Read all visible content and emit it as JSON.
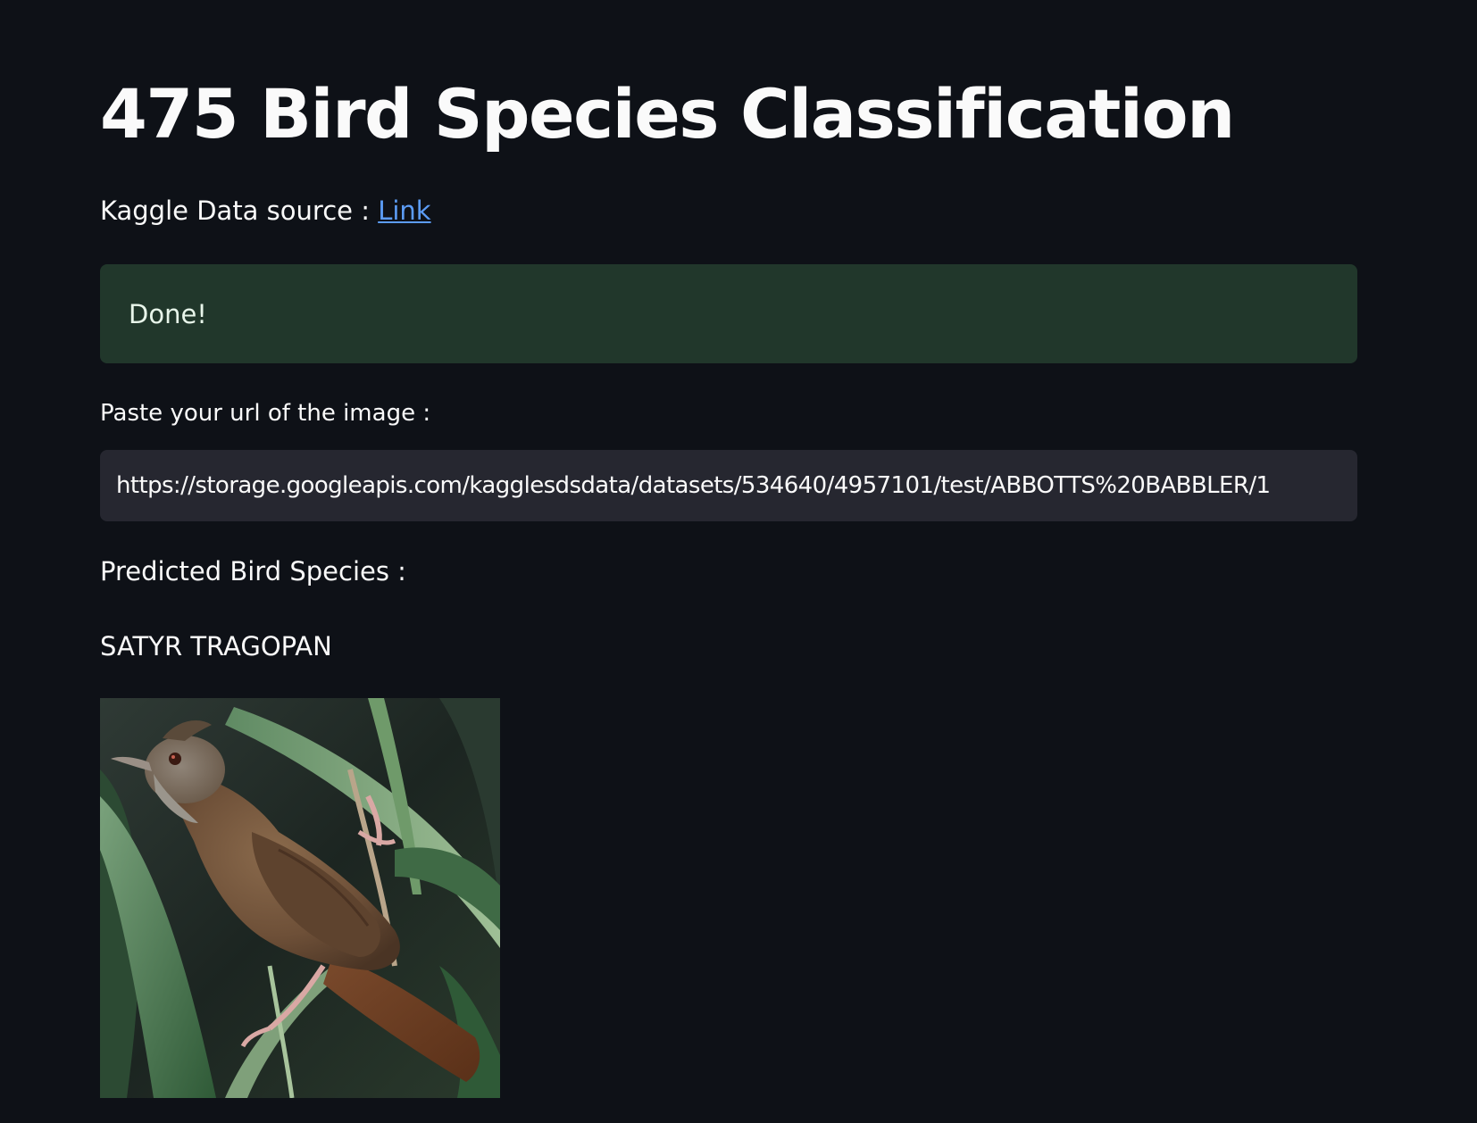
{
  "header": {
    "title": "475 Bird Species Classification"
  },
  "source": {
    "prefix": "Kaggle Data source : ",
    "link_label": "Link"
  },
  "status": {
    "message": "Done!"
  },
  "url_input": {
    "label": "Paste your url of the image :",
    "value": "https://storage.googleapis.com/kagglesdsdata/datasets/534640/4957101/test/ABBOTTS%20BABBLER/1"
  },
  "prediction": {
    "label": "Predicted Bird Species :",
    "value": "SATYR TRAGOPAN"
  },
  "colors": {
    "background": "#0e1117",
    "link": "#5c9cf5",
    "success_bg": "#21372b",
    "input_bg": "#262730"
  },
  "image": {
    "icon": "bird-photo"
  }
}
